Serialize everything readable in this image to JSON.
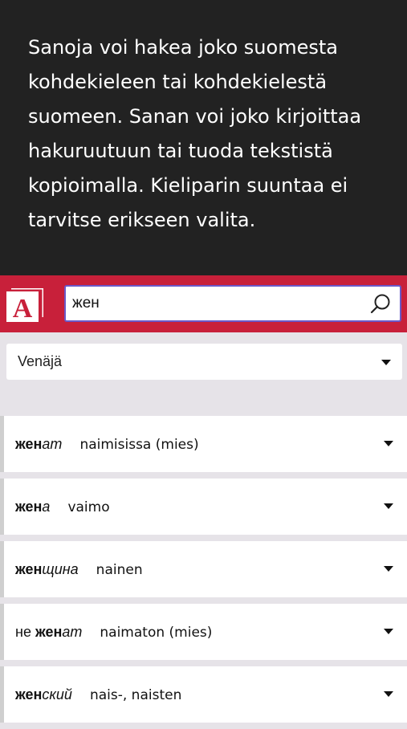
{
  "intro": {
    "text": "Sanoja voi hakea joko suomesta kohdekieleen tai kohdekielestä suomeen. Sanan voi joko kirjoittaa hakuruutuun tai tuoda tekstistä kopioimalla. Kieliparin suuntaa ei tarvitse erikseen valita."
  },
  "logo": {
    "letter": "A",
    "color": "#c8203a"
  },
  "search": {
    "value": "жен",
    "icon": "search-icon"
  },
  "language": {
    "selected": "Venäjä"
  },
  "results": [
    {
      "prefix": "",
      "stem": "жен",
      "ending": "ат",
      "translation": "naimisissa (mies)"
    },
    {
      "prefix": "",
      "stem": "жен",
      "ending": "а",
      "translation": "vaimo"
    },
    {
      "prefix": "",
      "stem": "жен",
      "ending": "щина",
      "translation": "nainen"
    },
    {
      "prefix": "не ",
      "stem": "жен",
      "ending": "ат",
      "translation": "naimaton (mies)"
    },
    {
      "prefix": "",
      "stem": "жен",
      "ending": "ский",
      "translation": "nais-, naisten"
    }
  ],
  "colors": {
    "header_bg": "#222222",
    "brand_red": "#c8203a",
    "focus_border": "#6a58c8"
  }
}
